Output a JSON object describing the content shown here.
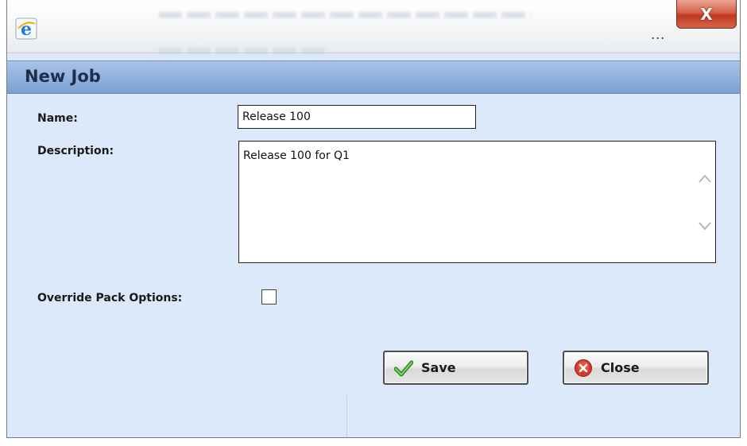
{
  "window": {
    "close_glyph": "X",
    "ellipsis": "...",
    "icon": "ie-icon"
  },
  "dialog": {
    "title": "New Job"
  },
  "form": {
    "name_label": "Name:",
    "name_value": "Release 100",
    "description_label": "Description:",
    "description_value": "Release 100 for Q1",
    "override_label": "Override Pack Options:",
    "override_checked": false
  },
  "buttons": {
    "save_label": "Save",
    "save_icon": "checkmark-icon",
    "close_label": "Close",
    "close_icon": "close-circle-icon"
  },
  "colors": {
    "dialog_background": "#dce9fb",
    "header_bar": "#92b2e0",
    "close_button": "#c9462c",
    "check_green": "#3aa32d",
    "close_icon_red": "#d43a2a"
  }
}
